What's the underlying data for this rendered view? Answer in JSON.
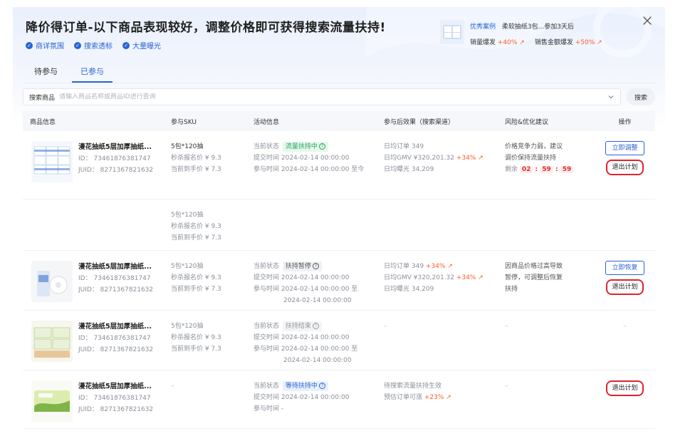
{
  "header": {
    "title": "降价得订单-以下商品表现较好，调整价格即可获得搜索流量扶持!",
    "features": [
      "商详氛围",
      "搜索透标",
      "大量曝光"
    ],
    "case": {
      "tag": "优秀案例",
      "desc": "柔软抽纸3包...参加3天后",
      "metric1_label": "销量爆发",
      "metric1_value": "+40% ↗",
      "metric2_label": "销售金额爆发",
      "metric2_value": "+50% ↗"
    }
  },
  "tabs": [
    {
      "label": "待参与",
      "active": false
    },
    {
      "label": "已参与",
      "active": true
    }
  ],
  "search": {
    "label": "搜索商品",
    "placeholder": "请输入商品名称或商品ID进行查询",
    "button": "搜索"
  },
  "table": {
    "headers": [
      "商品信息",
      "参与SKU",
      "活动信息",
      "参与后效果（搜索渠道）",
      "风险&优化建议",
      "操作"
    ],
    "rows": [
      {
        "name": "漫花抽纸5层加厚抽纸...",
        "id": "ID： 73461876381747",
        "juid": "JUID： 8271367821632",
        "sku_spec": "5包*120抽",
        "sku_price1": "秒杀报名价 ¥ 9.3",
        "sku_price2": "当前到手价 ¥ 7.3",
        "status_label": "当前状态",
        "status": "流量扶持中",
        "submit": "提交时间 2024-02-14 00:00:00",
        "join": "参与时间 2024-02-14 00:00:00 至今",
        "eff1": "日均订单 349",
        "eff1_up": "",
        "eff2": "日均GMV ¥320,201.32",
        "eff2_up": "+34% ↗",
        "eff3": "日均曝光 34,209",
        "risk1": "价格竞争力弱，建议",
        "risk2": "调价保持流量扶持",
        "countdown_label": "剩余",
        "countdown": [
          "02",
          "59",
          "59"
        ],
        "btn1": "立即调整",
        "btn2": "退出计划"
      },
      {
        "sku_spec": "5包*120抽",
        "sku_price1": "秒杀报名价 ¥ 9.3",
        "sku_price2": "当前到手价 ¥ 7.3"
      },
      {
        "name": "漫花抽纸5层加厚抽纸...",
        "id": "ID： 73461876381747",
        "juid": "JUID： 8271367821632",
        "sku_spec": "5包*120抽",
        "sku_price1": "秒杀报名价 ¥ 9.3",
        "sku_price2": "当前到手价 ¥ 7.3",
        "status_label": "当前状态",
        "status": "扶持暂停",
        "submit": "提交时间 2024-02-14 00:00:00",
        "join": "参与时间 2024-02-14 00:00:00 至",
        "join2": "2024-02-14 00:00:00",
        "eff1": "日均订单 349",
        "eff1_up": "+34% ↗",
        "eff2": "日均GMV ¥320,201.32",
        "eff2_up": "+34% ↗",
        "eff3": "日均曝光 34,209",
        "risk1": "因商品价格过高导致",
        "risk2": "暂停，可调整后恢复",
        "risk3": "扶持",
        "btn1": "立即恢复",
        "btn2": "退出计划"
      },
      {
        "name": "漫花抽纸5层加厚抽纸...",
        "id": "ID： 73461876381747",
        "juid": "JUID： 8271367821632",
        "sku_spec": "5包*120抽",
        "sku_price1": "秒杀报名价 ¥ 9.3",
        "sku_price2": "当前到手价 ¥ 7.3",
        "status_label": "当前状态",
        "status": "扶持结束",
        "submit": "提交时间 2024-02-14 00:00:00",
        "join": "参与时间 2024-02-14 00:00:00 至",
        "join2": "2024-02-14 00:00:00",
        "eff_dash": "–",
        "risk_dash": "–",
        "op_dash": "–"
      },
      {
        "name": "漫花抽纸5层加厚抽纸...",
        "id": "ID： 73461876381747",
        "juid": "JUID： 8271367821632",
        "sku_dash": "–",
        "status_label": "当前状态",
        "status": "等待扶持中",
        "submit": "提交时间 2024-02-14 00:00:00",
        "join": "参与时间 -",
        "eff1": "待搜索流量扶持生效",
        "eff2": "预估订单可涨",
        "eff2_up": "+23% ↗",
        "risk_dash": "–",
        "btn2": "退出计划"
      }
    ]
  },
  "colors": {
    "accent": "#2a63d6",
    "up": "#ff5a2c",
    "countdown": "#e32b2b",
    "highlight_outline": "#e0232e"
  }
}
